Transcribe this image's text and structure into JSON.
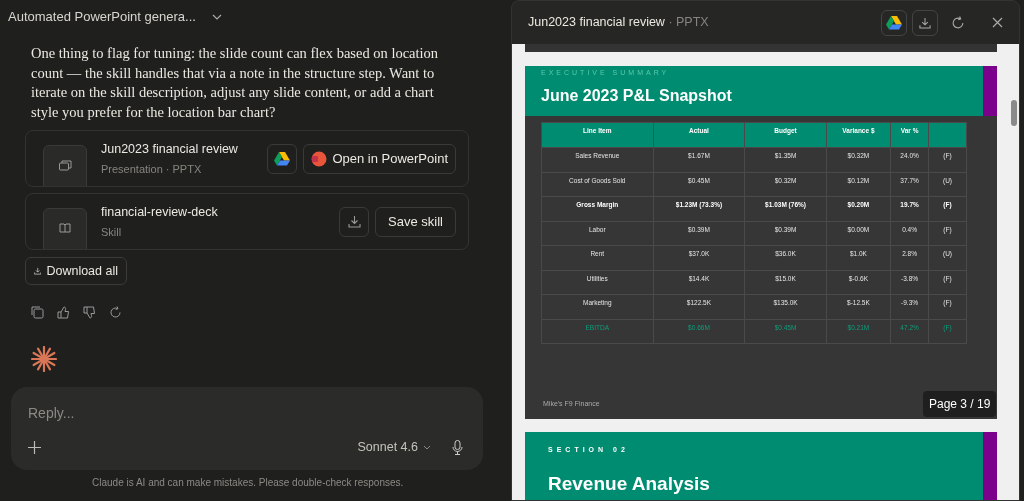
{
  "chat": {
    "title": "Automated PowerPoint genera...",
    "message": "One thing to flag for tuning: the slide count can flex based on location count — the skill handles that via a note in the structure step. Want to iterate on the skill description, adjust any slide content, or add a chart style you prefer for the location bar chart?",
    "files": [
      {
        "kind": "presentation",
        "name": "Jun2023 financial review",
        "meta": "Presentation · PPTX",
        "action": "Open in PowerPoint"
      },
      {
        "kind": "skill",
        "name": "financial-review-deck",
        "meta": "Skill",
        "action": "Save skill"
      }
    ],
    "download_all": "Download all",
    "composer": {
      "placeholder": "Reply...",
      "model": "Sonnet 4.6"
    },
    "disclaimer": "Claude is AI and can make mistakes. Please double-check responses."
  },
  "preview": {
    "title": "Jun2023 financial review",
    "format": "· PPTX",
    "slide": {
      "eyebrow": "EXECUTIVE SUMMARY",
      "title": "June 2023 P&L Snapshot",
      "footer": "Mike's F9 Finance",
      "columns": [
        "Line Item",
        "Actual",
        "Budget",
        "Variance $",
        "Var %"
      ],
      "rows": [
        {
          "kind": "normal",
          "cells": [
            "Sales Revenue",
            "$1.67M",
            "$1.35M",
            "$0.32M",
            "24.0%",
            "(F)"
          ]
        },
        {
          "kind": "normal",
          "cells": [
            "Cost of Goods Sold",
            "$0.45M",
            "$0.32M",
            "$0.12M",
            "37.7%",
            "(U)"
          ]
        },
        {
          "kind": "bold",
          "cells": [
            "Gross Margin",
            "$1.23M (73.3%)",
            "$1.03M (76%)",
            "$0.20M",
            "19.7%",
            "(F)"
          ]
        },
        {
          "kind": "normal",
          "cells": [
            "Labor",
            "$0.39M",
            "$0.39M",
            "$0.00M",
            "0.4%",
            "(F)"
          ]
        },
        {
          "kind": "normal",
          "cells": [
            "Rent",
            "$37.0K",
            "$36.0K",
            "$1.0K",
            "2.8%",
            "(U)"
          ]
        },
        {
          "kind": "normal",
          "cells": [
            "Utilities",
            "$14.4K",
            "$15.0K",
            "$-0.6K",
            "-3.8%",
            "(F)"
          ]
        },
        {
          "kind": "normal",
          "cells": [
            "Marketing",
            "$122.5K",
            "$135.0K",
            "$-12.5K",
            "-9.3%",
            "(F)"
          ]
        },
        {
          "kind": "total",
          "cells": [
            "EBITDA",
            "$0.66M",
            "$0.45M",
            "$0.21M",
            "47.2%",
            "(F)"
          ]
        }
      ]
    },
    "page": "Page 3 / 19",
    "next_slide": {
      "eyebrow": "SECTION 02",
      "title": "Revenue Analysis"
    }
  }
}
